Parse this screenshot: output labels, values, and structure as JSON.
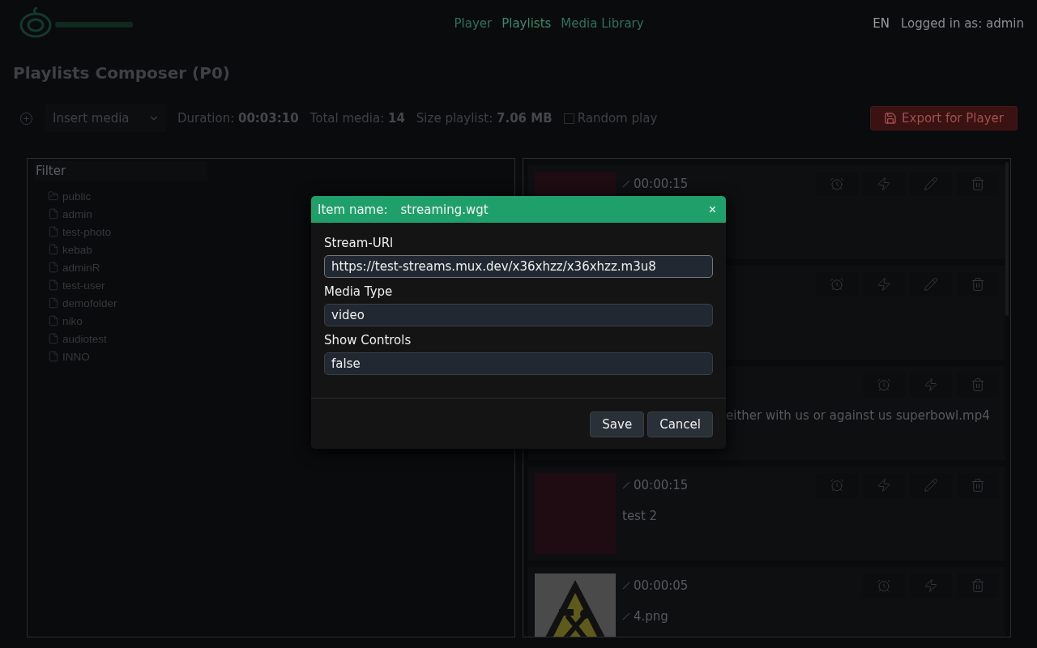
{
  "header": {
    "nav": [
      {
        "label": "Player",
        "selected": false
      },
      {
        "label": "Playlists",
        "selected": true
      },
      {
        "label": "Media Library",
        "selected": false
      }
    ],
    "language": {
      "label": "EN",
      "selected": true
    },
    "user": "Logged in as: admin"
  },
  "title": "Playlists Composer (P0)",
  "toolbar": {
    "insert": "Insert media",
    "stats": [
      {
        "label": "Duration:",
        "value": "00:03:10"
      },
      {
        "label": "Total media:",
        "value": "14"
      },
      {
        "label": "Size playlist:",
        "value": "7.06 MB"
      }
    ],
    "random_play": {
      "label": "Random play",
      "checked": false
    },
    "export": "Export for Player"
  },
  "library": {
    "filter_placeholder": "Filter",
    "items": [
      {
        "name": "public",
        "kind": "folder"
      },
      {
        "name": "admin",
        "kind": "file"
      },
      {
        "name": "test-photo",
        "kind": "file"
      },
      {
        "name": "kebab",
        "kind": "file"
      },
      {
        "name": "adminR",
        "kind": "file"
      },
      {
        "name": "test-user",
        "kind": "file"
      },
      {
        "name": "demofolder",
        "kind": "file"
      },
      {
        "name": "niko",
        "kind": "file"
      },
      {
        "name": "audiotest",
        "kind": "file"
      },
      {
        "name": "INNO",
        "kind": "file"
      }
    ]
  },
  "playlist": [
    {
      "kind": "color",
      "duration": "00:00:15",
      "editable": true
    },
    {
      "kind": "hidden",
      "editable": true
    },
    {
      "kind": "hidden",
      "editable": false,
      "name": "either with us or against us superbowl.mp4",
      "name_cut": true,
      "name_editable": false
    },
    {
      "kind": "color",
      "duration": "00:00:15",
      "name": "test 2",
      "editable": true,
      "name_editable": false
    },
    {
      "kind": "picture",
      "duration": "00:00:05",
      "name": "4.png",
      "editable": false,
      "name_editable": true
    }
  ],
  "dialog": {
    "title_label": "Item name:",
    "item_name": "streaming.wgt",
    "close": "×",
    "fields": [
      {
        "label": "Stream-URl",
        "value": "https://test-streams.mux.dev/x36xhzz/x36xhzz.m3u8",
        "focused": true
      },
      {
        "label": "Media Type",
        "value": "video",
        "focused": false
      },
      {
        "label": "Show Controls",
        "value": "false",
        "focused": false
      }
    ],
    "buttons": [
      "Save",
      "Cancel"
    ]
  }
}
